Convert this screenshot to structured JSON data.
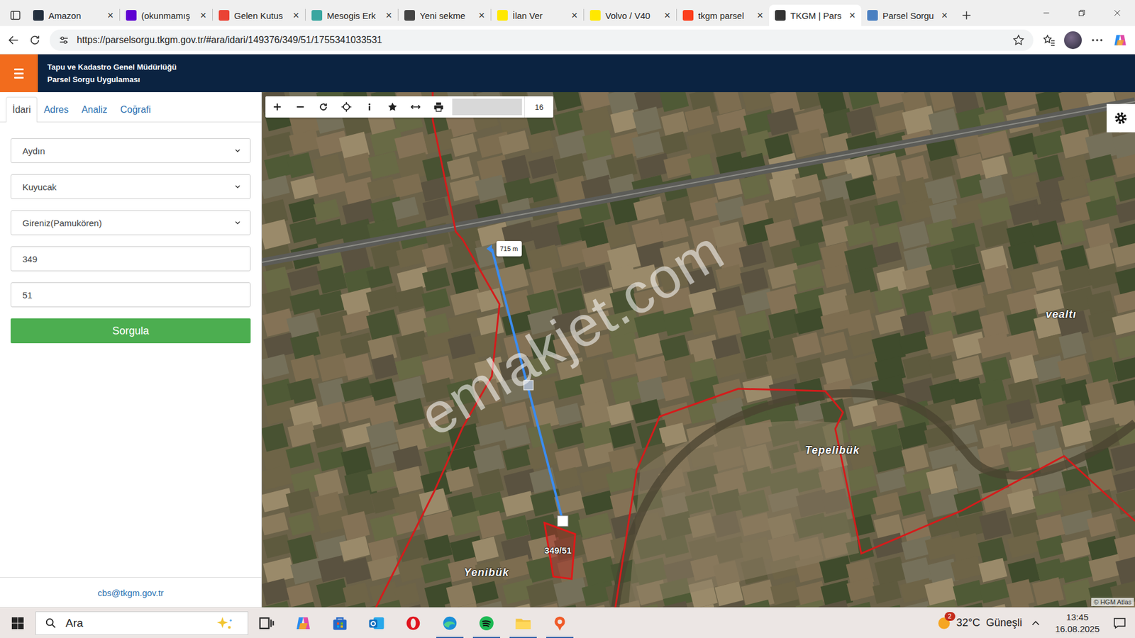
{
  "browser": {
    "tabs": [
      {
        "label": "Amazon",
        "selected": false,
        "color": "#232f3e"
      },
      {
        "label": "(okunmamış",
        "selected": false,
        "color": "#6001d2"
      },
      {
        "label": "Gelen Kutus",
        "selected": false,
        "color": "#ea4335"
      },
      {
        "label": "Mesogis Erk",
        "selected": false,
        "color": "#3aa6a0"
      },
      {
        "label": "Yeni sekme",
        "selected": false,
        "color": "#444444"
      },
      {
        "label": "İlan Ver",
        "selected": false,
        "color": "#ffe800"
      },
      {
        "label": "Volvo / V40",
        "selected": false,
        "color": "#ffe800"
      },
      {
        "label": "tkgm parsel",
        "selected": false,
        "color": "#fc3f1d"
      },
      {
        "label": "TKGM | Pars",
        "selected": true,
        "color": "#333333"
      },
      {
        "label": "Parsel Sorgu",
        "selected": false,
        "color": "#4a7fc1"
      }
    ],
    "close_glyph": "×",
    "url": "https://parselsorgu.tkgm.gov.tr/#ara/idari/149376/349/51/1755341033531"
  },
  "header": {
    "title": "Tapu ve Kadastro Genel Müdürlüğü",
    "subtitle": "Parsel Sorgu Uygulaması"
  },
  "sidebar": {
    "tabs": [
      {
        "label": "İdari",
        "selected": true
      },
      {
        "label": "Adres",
        "selected": false
      },
      {
        "label": "Analiz",
        "selected": false
      },
      {
        "label": "Coğrafi",
        "selected": false
      }
    ],
    "fields": [
      {
        "kind": "select",
        "value": "Aydın"
      },
      {
        "kind": "select",
        "value": "Kuyucak"
      },
      {
        "kind": "select",
        "value": "Gireniz(Pamukören)"
      },
      {
        "kind": "input",
        "value": "349"
      },
      {
        "kind": "input",
        "value": "51"
      }
    ],
    "button": "Sorgula",
    "footer": "cbs@tkgm.gov.tr"
  },
  "map": {
    "zoom": "16",
    "distance": "715 m",
    "parcel": "349/51",
    "places": [
      "Yenibük",
      "Tepelibük",
      "vealtı"
    ],
    "watermark": "emlakjet.com",
    "attribution": "© HGM Atlas"
  },
  "taskbar": {
    "search": "Ara",
    "weather_badge": "2",
    "weather": "32°C  Güneşli",
    "time": "13:45",
    "date": "16.08.2025"
  }
}
